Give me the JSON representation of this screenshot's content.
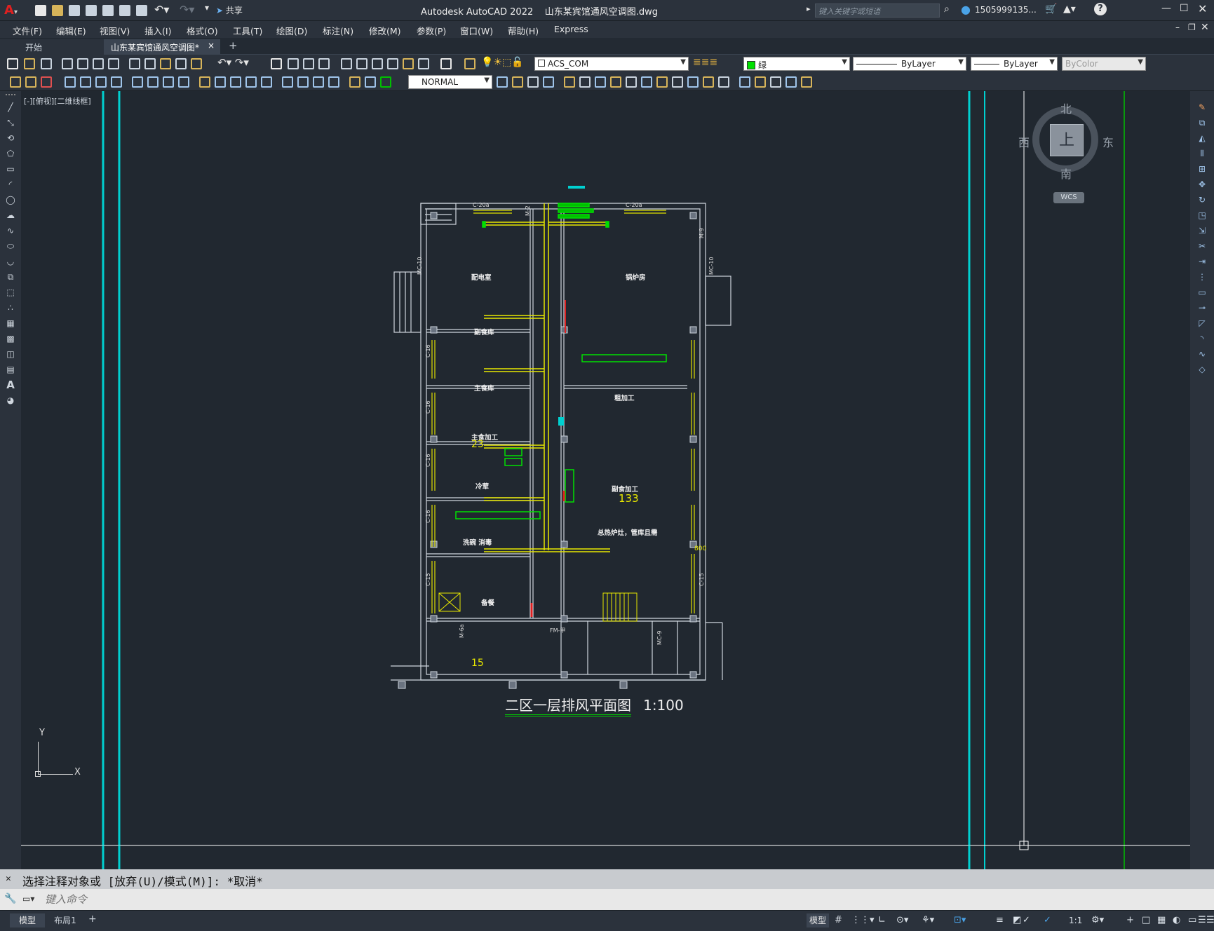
{
  "app": {
    "title": "Autodesk AutoCAD 2022    山东某宾馆通风空调图.dwg",
    "search_placeholder": "键入关键字或短语",
    "user": "1505999135...",
    "share_label": "共享"
  },
  "menu": [
    "文件(F)",
    "编辑(E)",
    "视图(V)",
    "插入(I)",
    "格式(O)",
    "工具(T)",
    "绘图(D)",
    "标注(N)",
    "修改(M)",
    "参数(P)",
    "窗口(W)",
    "帮助(H)",
    "Express"
  ],
  "tabs": {
    "start": "开始",
    "active": "山东某宾馆通风空调图*",
    "close": "×",
    "add": "+"
  },
  "toolbar": {
    "layer": "ACS_COM",
    "color": "绿",
    "linetype": "ByLayer",
    "lineweight": "ByLayer",
    "plotstyle": "ByColor",
    "textstyle": "NORMAL"
  },
  "viewport": {
    "label": "[-][俯视][二维线框]",
    "compass_n": "北",
    "compass_s": "南",
    "compass_e": "东",
    "compass_w": "西",
    "compass_top": "上",
    "wcs": "WCS",
    "ucs_x": "X",
    "ucs_y": "Y"
  },
  "drawing": {
    "title": "二区一层排风平面图",
    "scale": "1:100",
    "rooms": [
      "配电室",
      "锅炉房",
      "副食库",
      "主食库",
      "粗加工",
      "主食加工",
      "冷荤",
      "副食加工",
      "洗碗 消毒",
      "备餐",
      "总热炉灶，管库且需"
    ],
    "numbers": [
      "23",
      "133",
      "15",
      "800"
    ],
    "tags": [
      "C-20a",
      "C-20a",
      "M-2",
      "MC-10",
      "MC-10",
      "C-16",
      "C-16",
      "C-16",
      "C-16",
      "C-15",
      "C-15",
      "M-9",
      "MC-9",
      "FM-甲",
      "M-6a"
    ]
  },
  "command": {
    "history": "选择注释对象或 [放弃(U)/模式(M)]: *取消*",
    "placeholder": "键入命令"
  },
  "layout_tabs": [
    "模型",
    "布局1"
  ],
  "status": {
    "model": "模型",
    "scale": "1:1"
  }
}
